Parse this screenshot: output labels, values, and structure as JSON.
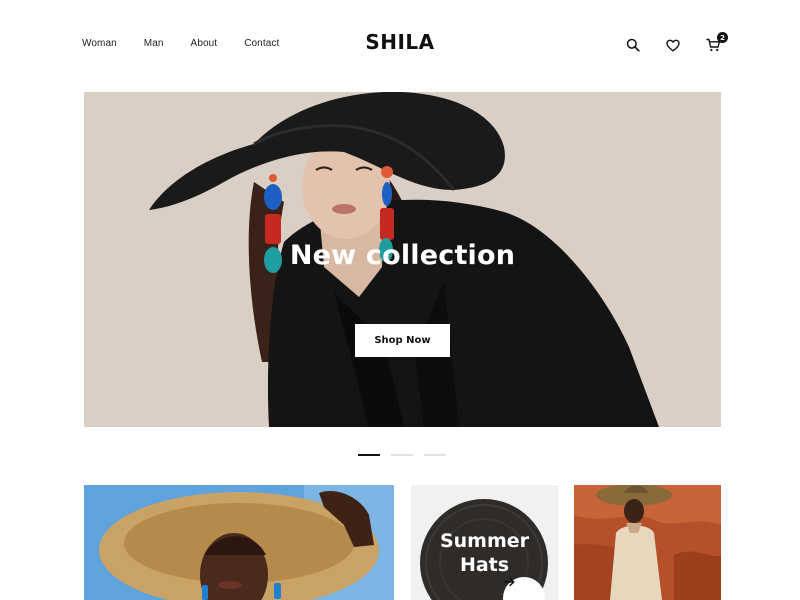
{
  "header": {
    "nav": [
      "Woman",
      "Man",
      "About",
      "Contact"
    ],
    "logo": "SHILA",
    "icons": [
      "search-icon",
      "heart-icon",
      "cart-icon"
    ],
    "cart_count": "2"
  },
  "hero": {
    "title": "New collection",
    "button_label": "Shop Now",
    "background_color": "#d9cfc4"
  },
  "carousel": {
    "slides": 3,
    "active_index": 0
  },
  "cards": [
    {
      "label": "",
      "image": "woman-straw-hat-photo"
    },
    {
      "label_line1": "Summer",
      "label_line2": "Hats",
      "image": "black-hat-photo"
    },
    {
      "label": "",
      "image": "woman-red-rocks-photo"
    }
  ],
  "colors": {
    "text": "#111111",
    "indicator_active": "#111111",
    "indicator_inactive": "#e2e2e2"
  }
}
